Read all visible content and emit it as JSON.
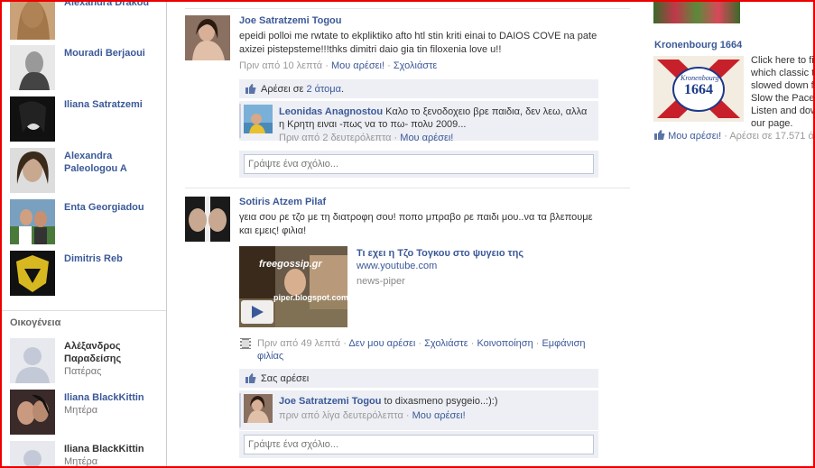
{
  "friends": [
    {
      "name": "Alexandra Drakou"
    },
    {
      "name": "Mouradi Berjaoui"
    },
    {
      "name": "Iliana Satratzemi"
    },
    {
      "name": "Alexandra Paleologou A"
    },
    {
      "name": "Enta Georgiadou"
    },
    {
      "name": "Dimitris Reb"
    }
  ],
  "family": {
    "header": "Οικογένεια",
    "members": [
      {
        "name": "Αλέξανδρος Παραδείσης",
        "relation": "Πατέρας"
      },
      {
        "name": "Iliana BlackKittin",
        "relation": "Μητέρα"
      },
      {
        "name": "Iliana BlackKittin",
        "relation": "Μητέρα"
      }
    ]
  },
  "stories": [
    {
      "author": "Joe Satratzemi Togou",
      "message": "epeidi polloi me rwtate to ekpliktiko afto htl stin kriti einai to DAIOS COVE na pate axizei pistepsteme!!!thks dimitri daio gia tin filoxenia love u!!",
      "time": "Πριν από 10 λεπτά",
      "like_link": "Μου αρέσει!",
      "comment_link": "Σχολιάστε",
      "likes_prefix": "Αρέσει σε",
      "likes_count": "2 άτομα",
      "likes_suffix": ".",
      "comment": {
        "author": "Leonidas Anagnostou",
        "text": "Καλο το ξενοδοχειο βρε παιδια, δεν λεω, αλλα η Κρητη ειναι -πως να το πω- πολυ 2009...",
        "time": "Πριν από 2 δευτερόλεπτα",
        "like_link": "Μου αρέσει!"
      },
      "write_placeholder": "Γράψτε ένα σχόλιο..."
    },
    {
      "author": "Sotiris Atzem Pilaf",
      "message": "γεια σου ρε τζο με τη διατροφη σου! ποπο μπραβο ρε παιδι μου..να τα βλεπουμε και εμεις! φιλια!",
      "video": {
        "title": "Τι εχει η Τζο Τογκου στο ψυγειο της",
        "url": "www.youtube.com",
        "source": "news-piper",
        "overlay_top": "freegossip.gr",
        "overlay_bottom": "piper.blogspot.com"
      },
      "time": "Πριν από 49 λεπτά",
      "unlike_link": "Δεν μου αρέσει",
      "comment_link": "Σχολιάστε",
      "share_link": "Κοινοποίηση",
      "friendship_link": "Εμφάνιση φιλίας",
      "likes_text": "Σας αρέσει",
      "comment": {
        "author": "Joe Satratzemi Togou",
        "text": "to dixasmeno psygeio..:):)",
        "time": "πριν από λίγα δευτερόλεπτα",
        "like_link": "Μου αρέσει!"
      },
      "write_placeholder": "Γράψτε ένα σχόλιο..."
    }
  ],
  "ad": {
    "title": "Kronenbourg 1664",
    "logo_brand": "Kronenbourg",
    "logo_number": "1664",
    "body_lines": [
      "Click here to fi",
      "which classic t",
      "slowed down f",
      "Slow the Pace",
      "Listen and dow",
      "our page."
    ],
    "like_link": "Μου αρέσει!",
    "likes_text": "· Αρέσει σε 17.571 ά"
  },
  "colors": {
    "link": "#3b5998",
    "panel": "#edeff4",
    "frame": "#e00000"
  }
}
